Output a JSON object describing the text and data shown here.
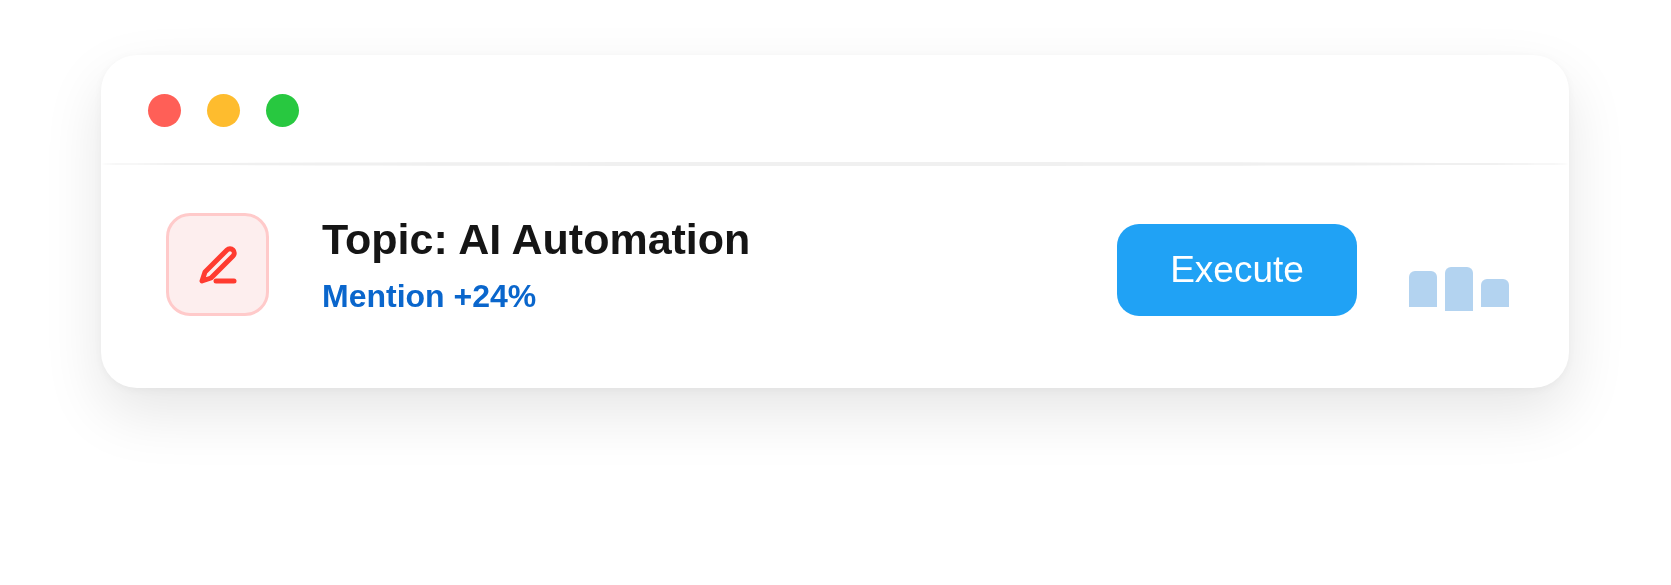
{
  "topic": {
    "title": "Topic: AI Automation",
    "trend": "Mention +24%"
  },
  "action_button": "Execute"
}
